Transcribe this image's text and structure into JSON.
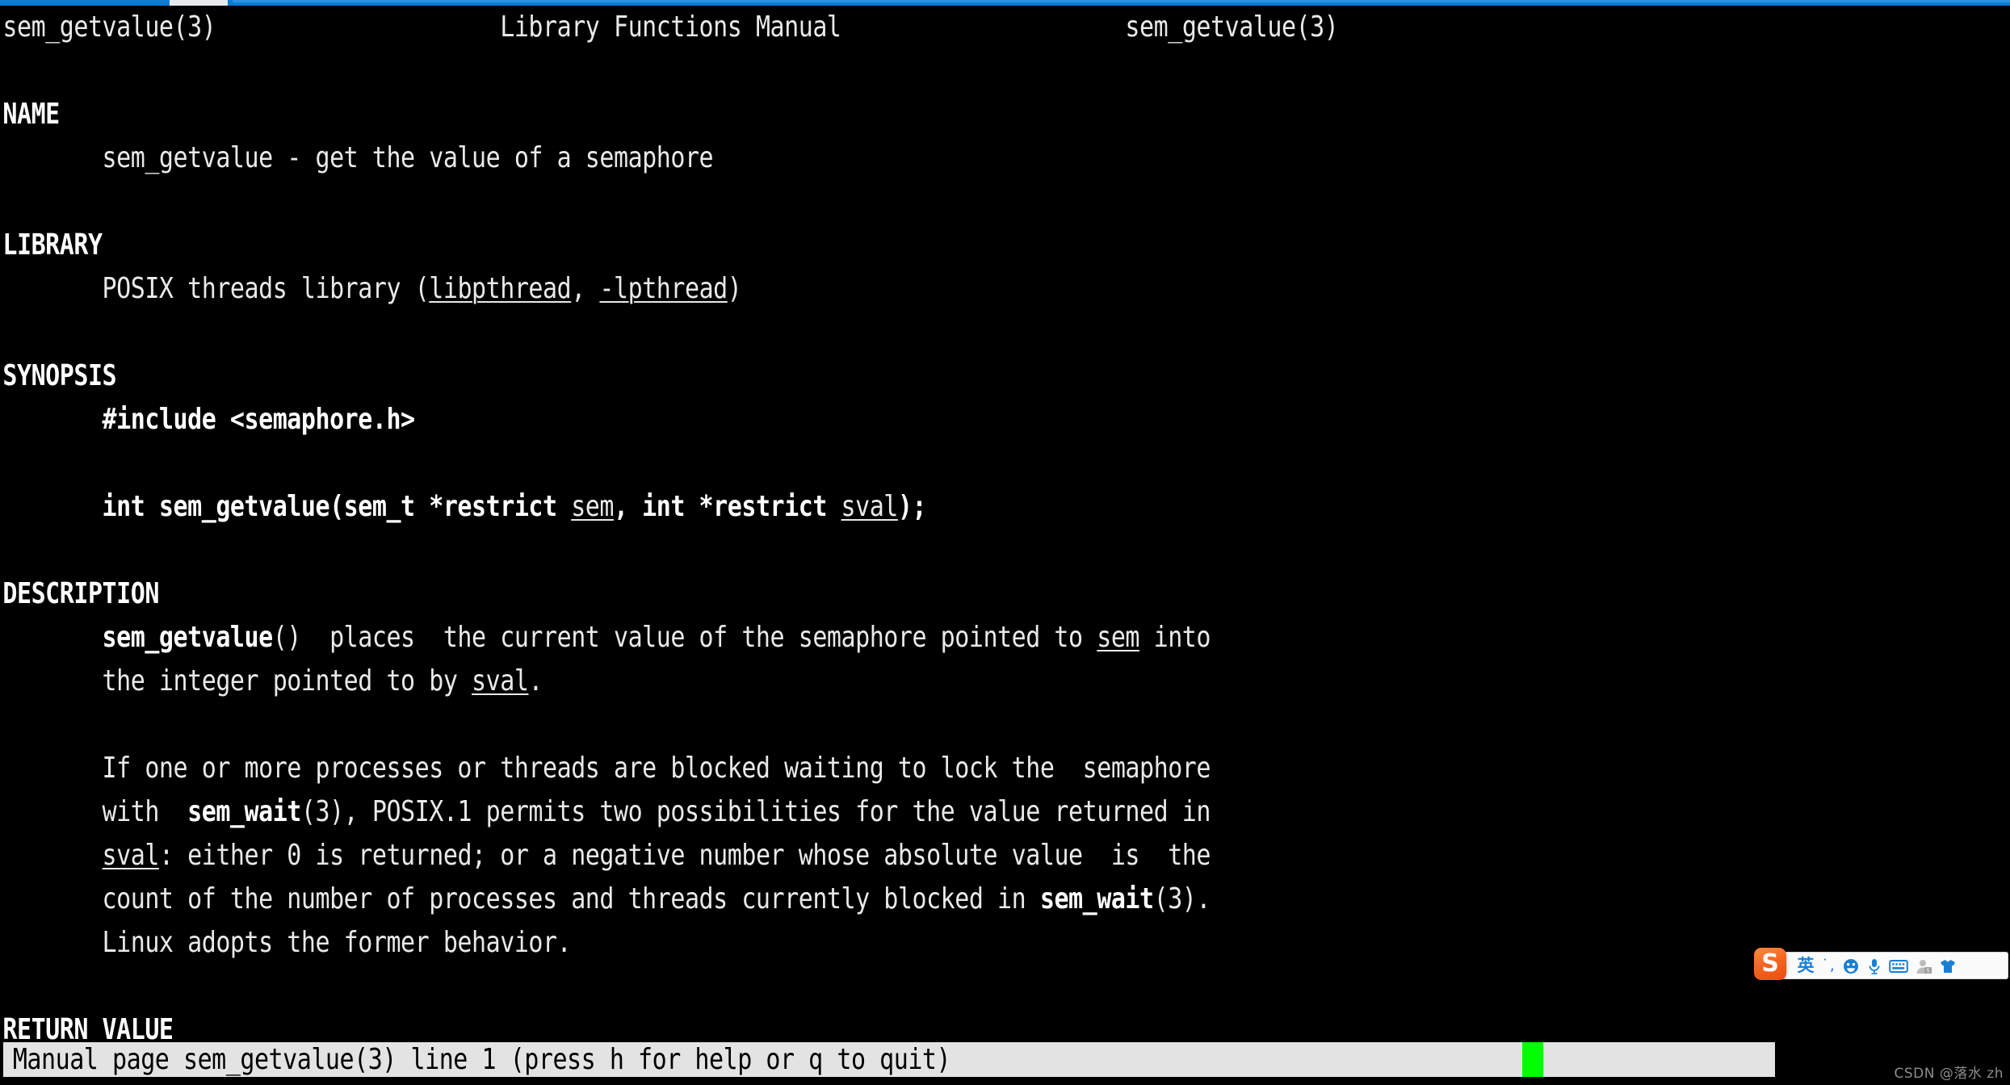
{
  "window": {
    "accent_color": "#0a7bd4",
    "tab_active_color": "#e8eaec"
  },
  "terminal": {
    "background": "#000000",
    "foreground": "#e9e9e9",
    "cursor_color": "#00ff00",
    "status_background": "#e3e3e3",
    "status_foreground": "#000000"
  },
  "man_header": {
    "left": "sem_getvalue(3)",
    "center": "Library Functions Manual",
    "right": "sem_getvalue(3)"
  },
  "sections": {
    "name": {
      "heading": "NAME",
      "body": "sem_getvalue - get the value of a semaphore"
    },
    "library": {
      "heading": "LIBRARY",
      "prefix": "POSIX threads library (",
      "link1": "libpthread",
      "sep": ", ",
      "link2": "-lpthread",
      "suffix": ")"
    },
    "synopsis": {
      "heading": "SYNOPSIS",
      "include": "#include <semaphore.h>",
      "proto_a": "int sem_getvalue(sem_t *restrict ",
      "proto_sem": "sem",
      "proto_b": ", int *restrict ",
      "proto_sval": "sval",
      "proto_c": ");"
    },
    "description": {
      "heading": "DESCRIPTION",
      "p1_bold": "sem_getvalue",
      "p1_a": "()  places  the current value of the semaphore pointed to ",
      "p1_sem": "sem",
      "p1_b": " into",
      "p1_line2_a": "the integer pointed to by ",
      "p1_line2_sval": "sval",
      "p1_line2_b": ".",
      "p2_l1": "If one or more processes or threads are blocked waiting to lock the  semaphore",
      "p2_l2_a": "with  ",
      "p2_l2_bold": "sem_wait",
      "p2_l2_b": "(3), POSIX.1 permits two possibilities for the value returned in",
      "p2_l3_sval": "sval",
      "p2_l3_a": ": either 0 is returned; or a negative number whose absolute value  is  the",
      "p2_l4_a": "count of the number of processes and threads currently blocked in ",
      "p2_l4_bold": "sem_wait",
      "p2_l4_b": "(3).",
      "p2_l5": "Linux adopts the former behavior."
    },
    "return_value": {
      "heading": "RETURN VALUE"
    }
  },
  "status_bar": {
    "text": "Manual page sem_getvalue(3) line 1 (press h for help or q to quit)"
  },
  "ime": {
    "logo_label": "S",
    "mode_label": "英",
    "punctuation_label": "˙,",
    "emoji_icon": "emoji-face-icon",
    "mic_icon": "microphone-icon",
    "keyboard_icon": "soft-keyboard-icon",
    "account_icon": "user-account-icon",
    "skin_icon": "skin-shirt-icon"
  },
  "watermark": {
    "text": "CSDN @落水 zh"
  }
}
